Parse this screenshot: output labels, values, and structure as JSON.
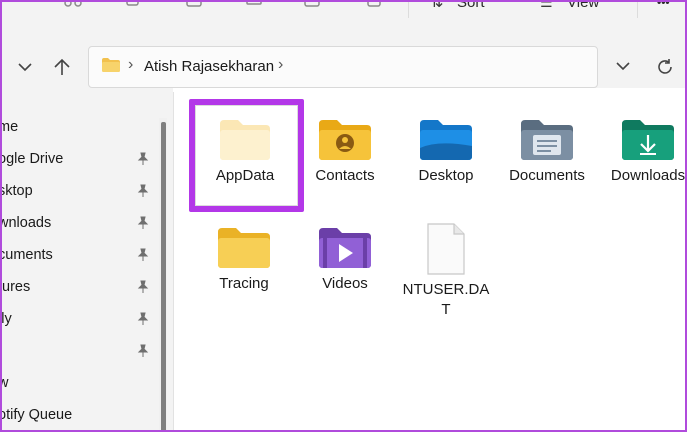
{
  "toolbar": {
    "sort_label": "Sort",
    "view_label": "View",
    "more_label": "•••"
  },
  "address": {
    "crumbs": [
      "Atish Rajasekharan"
    ]
  },
  "sidebar": {
    "items": [
      {
        "label": "me",
        "pinned": false
      },
      {
        "label": "ogle Drive",
        "pinned": true
      },
      {
        "label": "sktop",
        "pinned": true
      },
      {
        "label": "wnloads",
        "pinned": true
      },
      {
        "label": "cuments",
        "pinned": true
      },
      {
        "label": "tures",
        "pinned": true
      },
      {
        "label": "ily",
        "pinned": true
      },
      {
        "label": "",
        "pinned": true
      },
      {
        "label": "w",
        "pinned": false
      },
      {
        "label": "otify Queue",
        "pinned": false
      }
    ]
  },
  "files": [
    {
      "name": "AppData",
      "icon": "folder-hidden-icon",
      "selected": true
    },
    {
      "name": "Contacts",
      "icon": "contacts-folder-icon"
    },
    {
      "name": "Desktop",
      "icon": "desktop-folder-icon"
    },
    {
      "name": "Documents",
      "icon": "documents-folder-icon"
    },
    {
      "name": "Downloads",
      "icon": "downloads-folder-icon"
    },
    {
      "name": "Tracing",
      "icon": "folder-icon"
    },
    {
      "name": "Videos",
      "icon": "videos-folder-icon"
    },
    {
      "name": "NTUSER.DAT",
      "icon": "file-icon"
    }
  ],
  "colors": {
    "highlight": "#b337e8",
    "frame": "#b04bdc",
    "folder_yellow": "#f5c542"
  }
}
